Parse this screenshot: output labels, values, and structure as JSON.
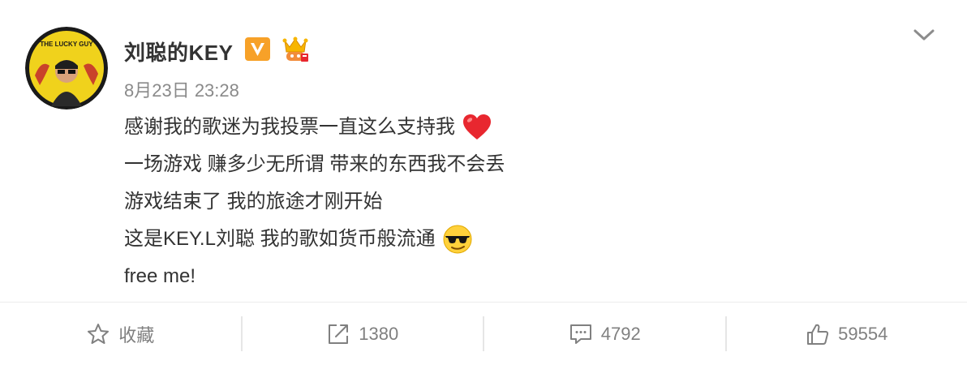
{
  "post": {
    "username": "刘聪的KEY",
    "timestamp": "8月23日 23:28",
    "lines": [
      "感谢我的歌迷为我投票一直这么支持我",
      "一场游戏 赚多少无所谓 带来的东西我不会丢",
      "游戏结束了 我的旅途才刚开始",
      "这是KEY.L刘聪 我的歌如货币般流通",
      "free me!"
    ],
    "avatar_text": "THE LUCKY GUY"
  },
  "badges": {
    "verified_icon": "v-verified-badge-icon",
    "member_icon": "crown-member-badge-icon"
  },
  "emojis": {
    "line1": "red-heart-icon",
    "line4": "cool-sunglasses-face-icon"
  },
  "actions": {
    "favorite": {
      "label": "收藏",
      "icon": "star-icon"
    },
    "repost": {
      "label": "1380",
      "icon": "share-icon"
    },
    "comment": {
      "label": "4792",
      "icon": "comment-icon"
    },
    "like": {
      "label": "59554",
      "icon": "thumbs-up-icon"
    }
  },
  "colors": {
    "text": "#333333",
    "muted": "#808080",
    "badge_orange": "#f7a128",
    "heart_red": "#e8272f"
  }
}
